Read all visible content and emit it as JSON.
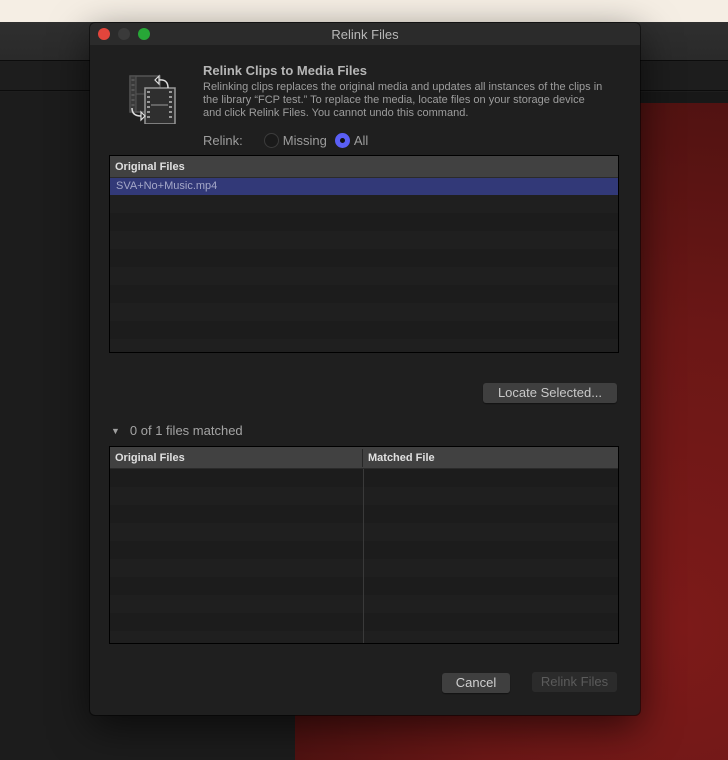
{
  "window": {
    "title": "Relink Files"
  },
  "header": {
    "icon": "relink-film-icon",
    "heading": "Relink Clips to Media Files",
    "description": "Relinking clips replaces the original media and updates all instances of the clips in the library “FCP test.” To replace the media, locate files on your storage device and click Relink Files. You cannot undo this command."
  },
  "relink": {
    "label": "Relink:",
    "options": [
      {
        "label": "Missing",
        "selected": false
      },
      {
        "label": "All",
        "selected": true
      }
    ]
  },
  "original_table": {
    "columns": [
      "Original Files"
    ],
    "rows": [
      {
        "name": "SVA+No+Music.mp4",
        "selected": true
      }
    ]
  },
  "locate_button": "Locate Selected...",
  "matched_section": {
    "disclosure": "expanded",
    "summary": "0 of 1 files matched",
    "columns": [
      "Original Files",
      "Matched File"
    ],
    "rows": []
  },
  "footer": {
    "cancel": "Cancel",
    "relink": "Relink Files",
    "relink_enabled": false
  },
  "colors": {
    "accent": "#5a5ff5",
    "selection": "#323978",
    "close": "#e2453c",
    "zoom": "#27a737"
  }
}
